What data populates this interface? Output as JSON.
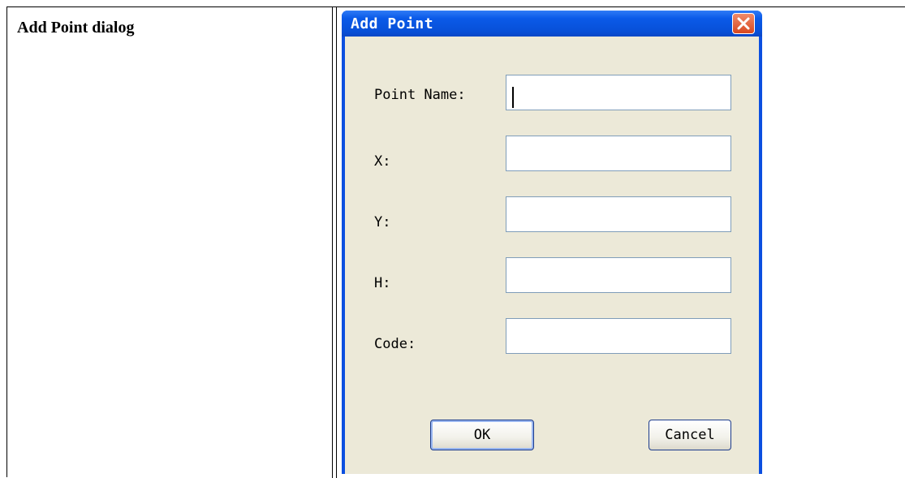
{
  "document": {
    "cell_label": "Add Point dialog"
  },
  "dialog": {
    "title": "Add Point",
    "fields": [
      {
        "label": "Point Name:",
        "value": ""
      },
      {
        "label": "X:",
        "value": ""
      },
      {
        "label": "Y:",
        "value": ""
      },
      {
        "label": "H:",
        "value": ""
      },
      {
        "label": "Code:",
        "value": ""
      }
    ],
    "ok_label": "OK",
    "cancel_label": "Cancel"
  },
  "colors": {
    "title_bar": "#0a5ae8",
    "client_bg": "#ece9d8",
    "close_button": "#d9481f"
  }
}
